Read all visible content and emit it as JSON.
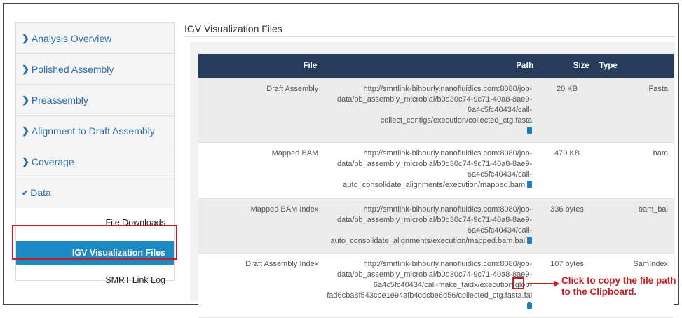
{
  "sidebar": {
    "items": [
      {
        "label": "Analysis Overview"
      },
      {
        "label": "Polished Assembly"
      },
      {
        "label": "Preassembly"
      },
      {
        "label": "Alignment to Draft Assembly"
      },
      {
        "label": "Coverage"
      }
    ],
    "data_section": {
      "label": "Data",
      "sub_items": [
        {
          "label": "File Downloads"
        },
        {
          "label": "IGV Visualization Files"
        },
        {
          "label": "SMRT Link Log"
        }
      ]
    }
  },
  "main": {
    "title": "IGV Visualization Files",
    "columns": {
      "file": "File",
      "path": "Path",
      "size": "Size",
      "type": "Type"
    },
    "rows": [
      {
        "file": "Draft Assembly",
        "path_lines": [
          "http://smrtlink-bihourly.nanofluidics.com:8080/job-",
          "data/pb_assembly_microbial/b0d30c74-9c71-40a8-8ae9-",
          "6a4c5fc40434/call-collect_contigs/execution/collected_ctg.fasta"
        ],
        "size": "20 KB",
        "type": "Fasta"
      },
      {
        "file": "Mapped BAM",
        "path_lines": [
          "http://smrtlink-bihourly.nanofluidics.com:8080/job-",
          "data/pb_assembly_microbial/b0d30c74-9c71-40a8-8ae9-",
          "6a4c5fc40434/call-",
          "auto_consolidate_alignments/execution/mapped.bam"
        ],
        "size": "470 KB",
        "type": "bam"
      },
      {
        "file": "Mapped BAM Index",
        "path_lines": [
          "http://smrtlink-bihourly.nanofluidics.com:8080/job-",
          "data/pb_assembly_microbial/b0d30c74-9c71-40a8-8ae9-",
          "6a4c5fc40434/call-",
          "auto_consolidate_alignments/execution/mapped.bam.bai"
        ],
        "size": "336 bytes",
        "type": "bam_bai"
      },
      {
        "file": "Draft Assembly Index",
        "path_lines": [
          "http://smrtlink-bihourly.nanofluidics.com:8080/job-",
          "data/pb_assembly_microbial/b0d30c74-9c71-40a8-8ae9-",
          "6a4c5fc40434/call-make_faidx/execution/glob-",
          "fad6cba8f543cbe1e94afb4cdcbe6d56/collected_ctg.fasta.fai"
        ],
        "size": "107 bytes",
        "type": "SamIndex"
      }
    ]
  },
  "annotation": {
    "line1": "Click to copy the file path",
    "line2": "to the Clipboard."
  },
  "colors": {
    "header_bg": "#273c5a",
    "active_bg": "#1b8ac4",
    "link": "#2a6ea8",
    "annotation_red": "#c21f23",
    "icon_blue": "#1f7fc0"
  },
  "icons": {
    "nav_collapsed": "chevron-right-icon",
    "nav_expanded": "chevron-down-icon",
    "copy": "clipboard-icon"
  }
}
